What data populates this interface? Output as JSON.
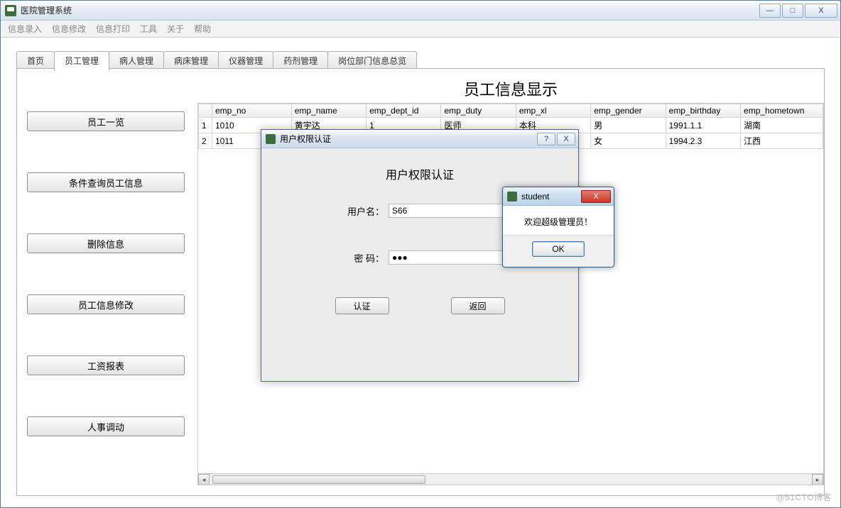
{
  "window": {
    "title": "医院管理系统",
    "min": "—",
    "max": "□",
    "close": "X"
  },
  "menubar": [
    "信息录入",
    "信息修改",
    "信息打印",
    "工具",
    "关于",
    "帮助"
  ],
  "tabs": [
    "首页",
    "员工管理",
    "病人管理",
    "病床管理",
    "仪器管理",
    "药剂管理",
    "岗位部门信息总览"
  ],
  "active_tab_index": 1,
  "side_buttons": [
    "员工一览",
    "条件查询员工信息",
    "删除信息",
    "员工信息修改",
    "工资报表",
    "人事调动"
  ],
  "page_heading": "员工信息显示",
  "table": {
    "columns": [
      "emp_no",
      "emp_name",
      "emp_dept_id",
      "emp_duty",
      "emp_xl",
      "emp_gender",
      "emp_birthday",
      "emp_hometown"
    ],
    "rows": [
      {
        "n": "1",
        "cells": [
          "1010",
          "黄宇达",
          "1",
          "医师",
          "本科",
          "男",
          "1991.1.1",
          "湖南"
        ]
      },
      {
        "n": "2",
        "cells": [
          "1011",
          "",
          "",
          "",
          "",
          "女",
          "1994.2.3",
          "江西"
        ]
      }
    ]
  },
  "auth_dialog": {
    "title": "用户权限认证",
    "heading": "用户权限认证",
    "username_label": "用户名：",
    "username_value": "S66",
    "password_label": "密  码：",
    "password_value": "●●●",
    "btn_confirm": "认证",
    "btn_back": "返回",
    "help": "?",
    "close": "X"
  },
  "msgbox": {
    "title": "student",
    "message": "欢迎超级管理员！",
    "ok": "OK",
    "close": "X"
  },
  "watermark": "@51CTO博客"
}
